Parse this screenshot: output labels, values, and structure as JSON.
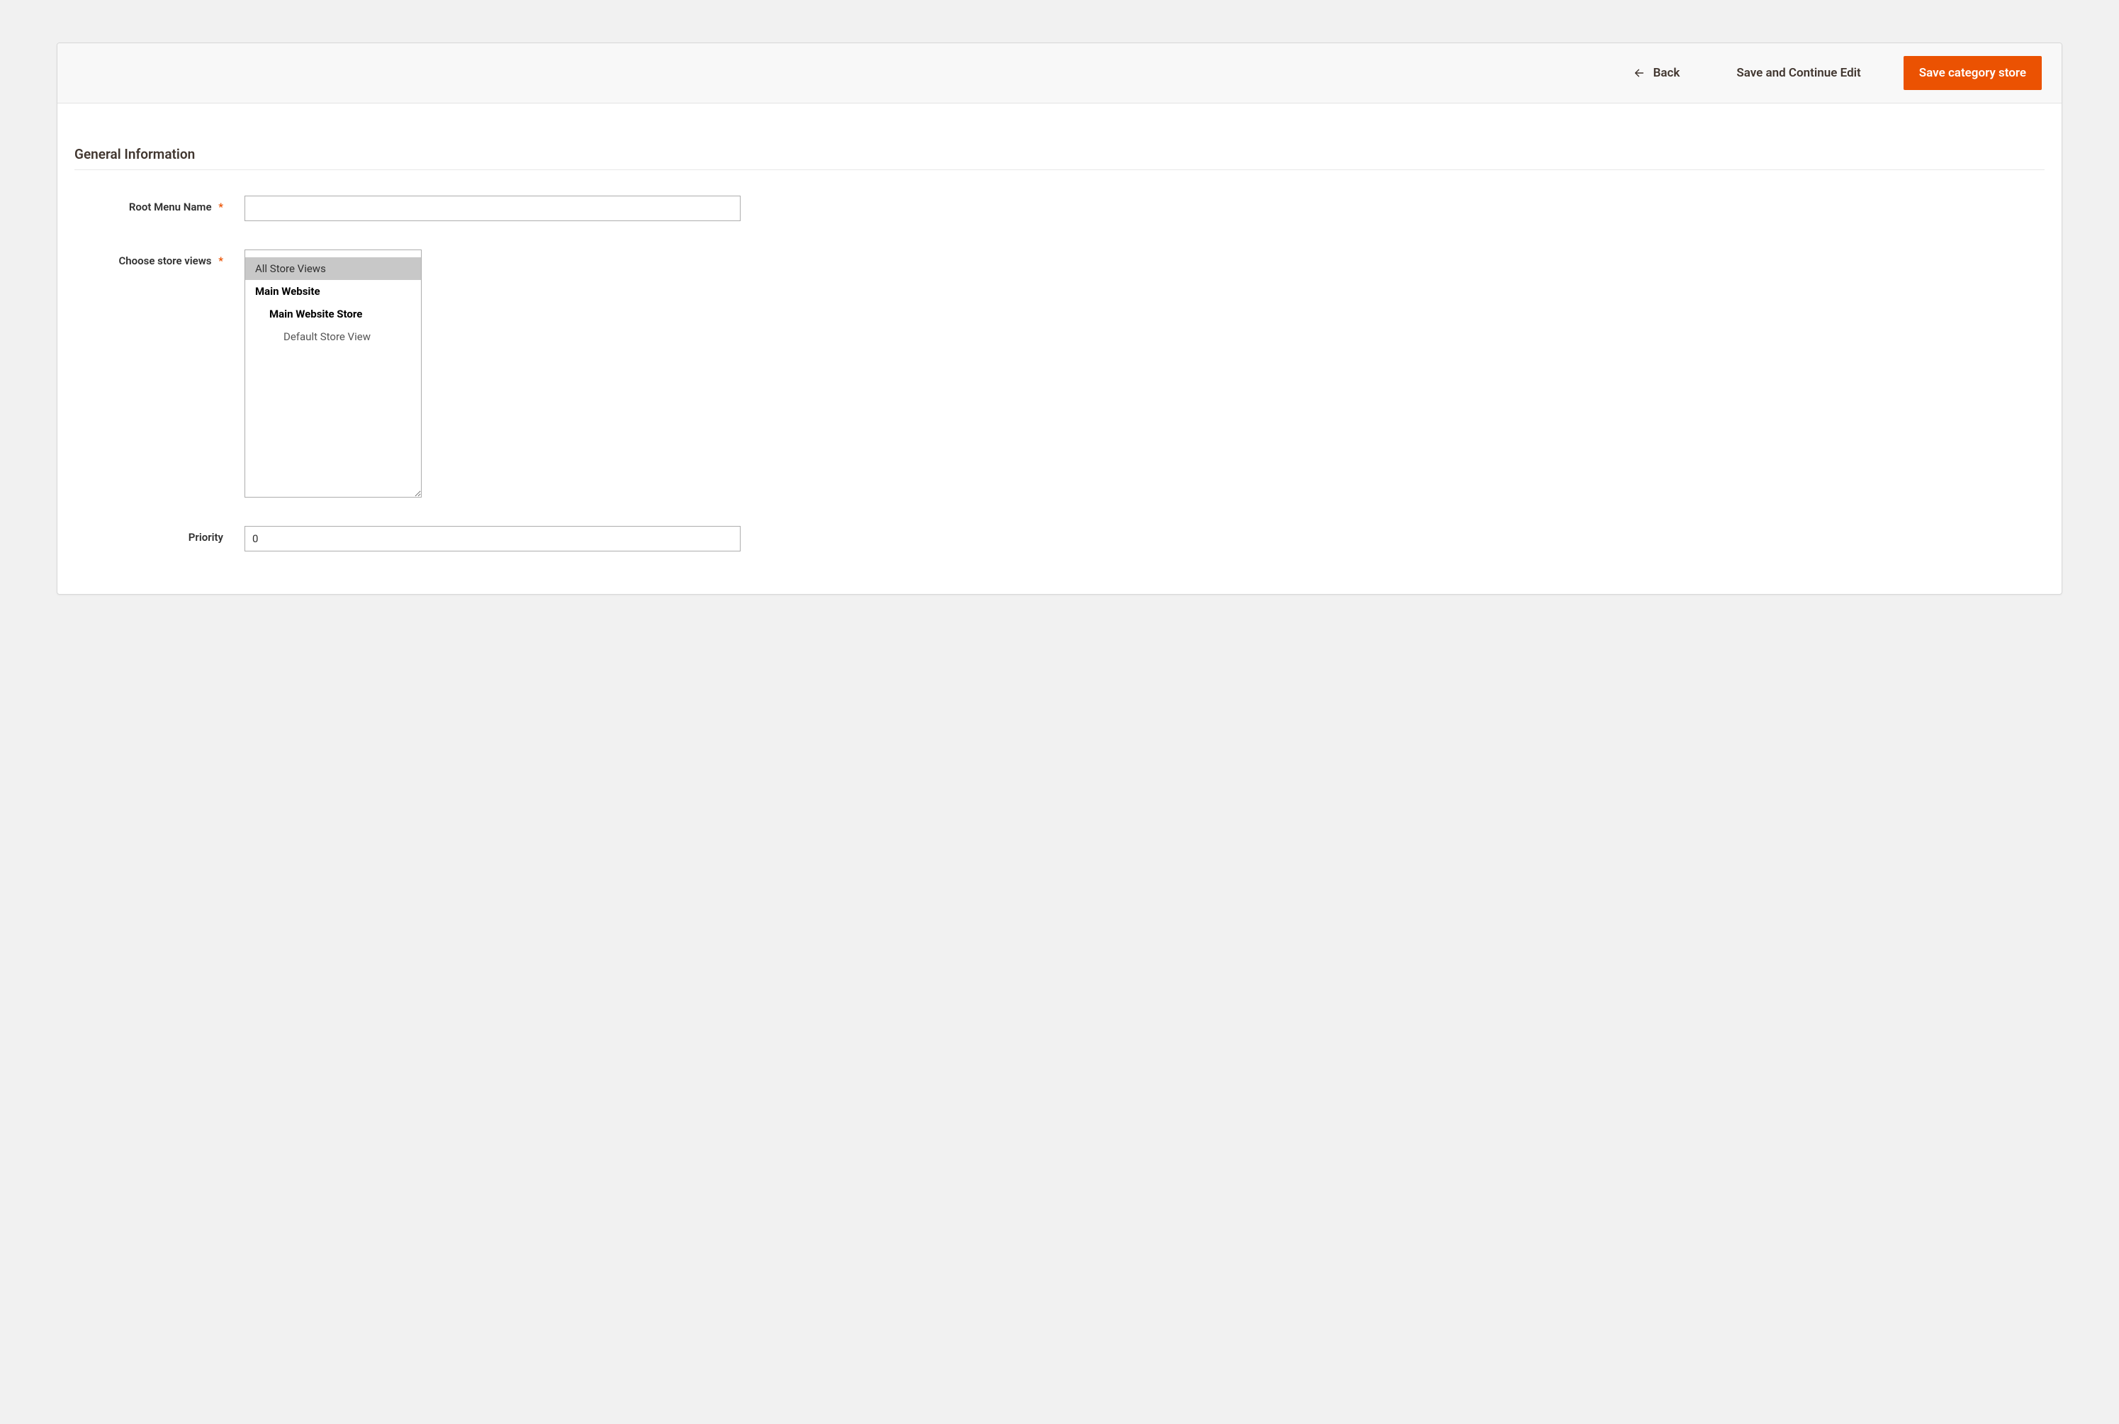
{
  "toolbar": {
    "back_label": "Back",
    "save_continue_label": "Save and Continue Edit",
    "save_label": "Save category store"
  },
  "section": {
    "title": "General Information"
  },
  "fields": {
    "root_menu_name": {
      "label": "Root Menu Name",
      "value": ""
    },
    "choose_store_views": {
      "label": "Choose store views",
      "options": [
        {
          "label": "All Store Views",
          "level": 0,
          "selected": true
        },
        {
          "label": "Main Website",
          "level": 1,
          "selected": false
        },
        {
          "label": "Main Website Store",
          "level": 2,
          "selected": false
        },
        {
          "label": "Default Store View",
          "level": 3,
          "selected": false
        }
      ]
    },
    "priority": {
      "label": "Priority",
      "value": "0"
    }
  }
}
